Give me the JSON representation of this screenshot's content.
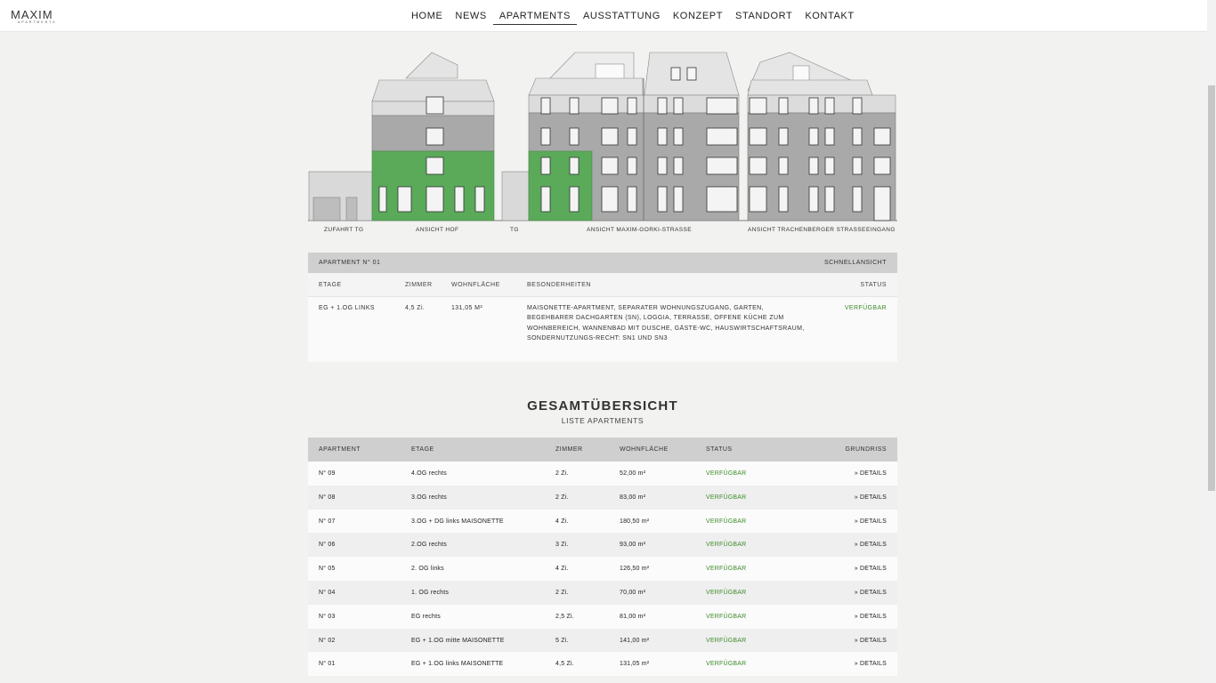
{
  "logo": {
    "main": "MAXIM",
    "sub": "APARTMENTS"
  },
  "nav": [
    "HOME",
    "NEWS",
    "APARTMENTS",
    "AUSSTATTUNG",
    "KONZEPT",
    "STANDORT",
    "KONTAKT"
  ],
  "elevation_labels": {
    "zufahrt": "ZUFAHRT TG",
    "hof": "ANSICHT HOF",
    "tg": "TG",
    "maxim": "ANSICHT MAXIM-GORKI-STRASSE",
    "trachenberger": "ANSICHT TRACHENBERGER STRASSE",
    "eingang": "EINGANG"
  },
  "detail": {
    "title": "APARTMENT N° 01",
    "quickview": "SCHNELLANSICHT",
    "cols": {
      "etage": "ETAGE",
      "zimmer": "ZIMMER",
      "flaeche": "WOHNFLÄCHE",
      "besonder": "BESONDERHEITEN",
      "status": "STATUS"
    },
    "row": {
      "etage": "EG + 1.OG LINKS",
      "zimmer": "4,5 Zi.",
      "flaeche": "131,05 M²",
      "besonder": "MAISONETTE-APARTMENT, SEPARATER WOHNUNGSZUGANG, GARTEN, BEGEHBARER DACHGARTEN (SN), LOGGIA, TERRASSE, OFFENE KÜCHE ZUM WOHNBEREICH, WANNENBAD MIT DUSCHE, GÄSTE-WC, HAUSWIRTSCHAFTSRAUM, SONDERNUTZUNGS-RECHT: SN1 UND SN3",
      "status": "VERFÜGBAR"
    }
  },
  "overview": {
    "title": "GESAMTÜBERSICHT",
    "subtitle": "LISTE APARTMENTS",
    "headers": {
      "apartment": "APARTMENT",
      "etage": "ETAGE",
      "zimmer": "ZIMMER",
      "flaeche": "WOHNFLÄCHE",
      "status": "STATUS",
      "grundriss": "GRUNDRISS"
    },
    "rows": [
      {
        "apt": "N° 09",
        "etage": "4.OG rechts",
        "zimmer": "2 Zi.",
        "flaeche": "52,00 m²",
        "status": "VERFÜGBAR",
        "link": "» DETAILS"
      },
      {
        "apt": "N° 08",
        "etage": "3.OG rechts",
        "zimmer": "2 Zi.",
        "flaeche": "83,00 m²",
        "status": "VERFÜGBAR",
        "link": "» DETAILS"
      },
      {
        "apt": "N° 07",
        "etage": "3.OG + DG links MAISONETTE",
        "zimmer": "4 Zi.",
        "flaeche": "180,50 m²",
        "status": "VERFÜGBAR",
        "link": "» DETAILS"
      },
      {
        "apt": "N° 06",
        "etage": "2.OG rechts",
        "zimmer": "3 Zi.",
        "flaeche": "93,00 m²",
        "status": "VERFÜGBAR",
        "link": "» DETAILS"
      },
      {
        "apt": "N° 05",
        "etage": "2. OG links",
        "zimmer": "4 Zi.",
        "flaeche": "126,50 m²",
        "status": "VERFÜGBAR",
        "link": "» DETAILS"
      },
      {
        "apt": "N° 04",
        "etage": "1. OG rechts",
        "zimmer": "2 Zi.",
        "flaeche": "70,00 m²",
        "status": "VERFÜGBAR",
        "link": "» DETAILS"
      },
      {
        "apt": "N° 03",
        "etage": "EG rechts",
        "zimmer": "2,5 Zi.",
        "flaeche": "81,00 m²",
        "status": "VERFÜGBAR",
        "link": "» DETAILS"
      },
      {
        "apt": "N° 02",
        "etage": "EG + 1.OG mitte MAISONETTE",
        "zimmer": "5 Zi.",
        "flaeche": "141,00 m²",
        "status": "VERFÜGBAR",
        "link": "» DETAILS"
      },
      {
        "apt": "N° 01",
        "etage": "EG + 1.OG links MAISONETTE",
        "zimmer": "4,5 Zi.",
        "flaeche": "131,05 m²",
        "status": "VERFÜGBAR",
        "link": "» DETAILS"
      }
    ]
  },
  "colors": {
    "status_green": "#3d8c2a",
    "highlight_green": "#5aaa5a",
    "header_gray": "#cfcfcf"
  }
}
